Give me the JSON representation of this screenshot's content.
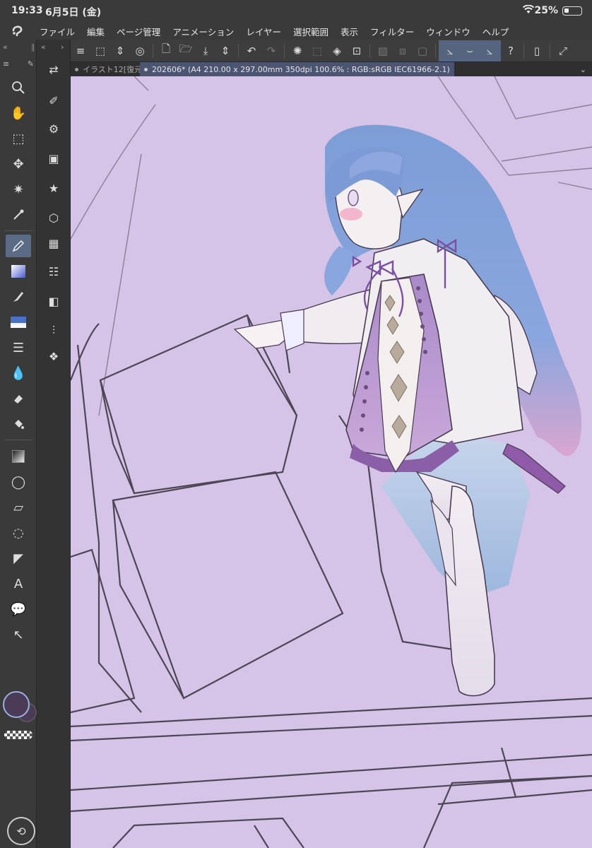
{
  "status_bar": {
    "time": "19:33",
    "date": "6月5日 (金)",
    "battery": "25%"
  },
  "menu": {
    "items": [
      "ファイル",
      "編集",
      "ページ管理",
      "アニメーション",
      "レイヤー",
      "選択範囲",
      "表示",
      "フィルター",
      "ウィンドウ",
      "ヘルプ"
    ]
  },
  "tabs": {
    "inactive_label": "イラスト12[復元",
    "active_label": "202606* (A4 210.00 x 297.00mm 350dpi 100.6% : RGB:sRGB IEC61966-2.1)"
  },
  "colors": {
    "canvas_bg": "#d5c4e8",
    "main_color": "#4b3b57",
    "accent": "#5b6b86"
  }
}
